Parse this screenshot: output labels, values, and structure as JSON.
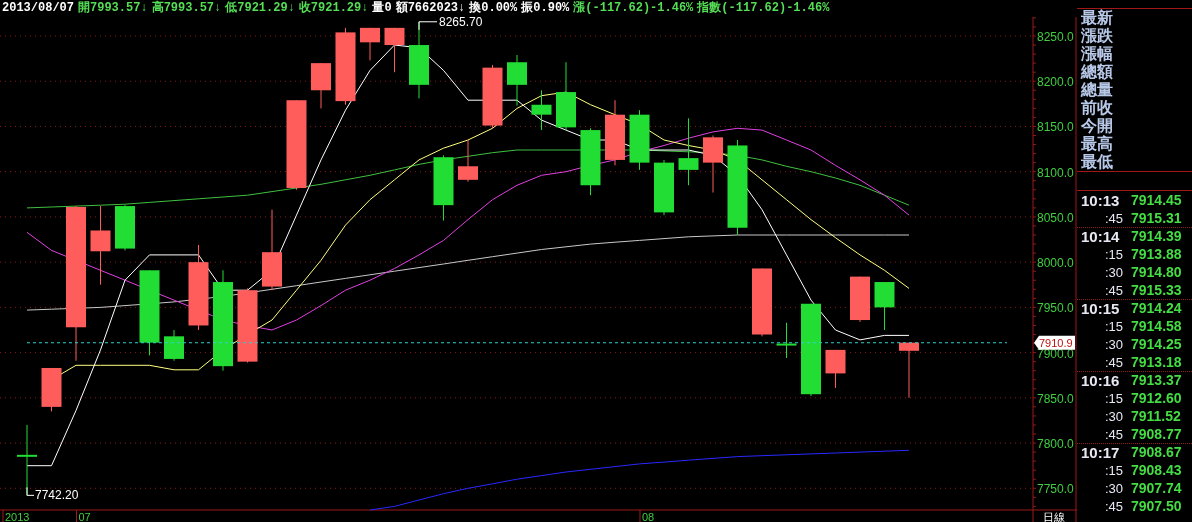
{
  "quote_bar": [
    {
      "text": "2013/08/07",
      "color": "#ffffff"
    },
    {
      "text": "開7993.57↓",
      "color": "#55dd55"
    },
    {
      "text": "高7993.57↓",
      "color": "#55dd55"
    },
    {
      "text": "低7921.29↓",
      "color": "#55dd55"
    },
    {
      "text": "收7921.29↓",
      "color": "#55dd55"
    },
    {
      "text": "量0",
      "color": "#ffffff"
    },
    {
      "text": "額7662023↓",
      "color": "#ffffff"
    },
    {
      "text": "換0.00%",
      "color": "#ffffff"
    },
    {
      "text": "振0.90%",
      "color": "#ffffff"
    },
    {
      "text": "漲(-117.62)-1.46%",
      "color": "#55dd55"
    },
    {
      "text": "指數(-117.62)-1.46%",
      "color": "#55dd55"
    }
  ],
  "chart": {
    "y_axis_labels": [
      "8250.0",
      "8200.0",
      "8150.0",
      "8100.0",
      "8050.0",
      "8000.0",
      "7950.0",
      "7900.0",
      "7850.0",
      "7800.0",
      "7750.0"
    ],
    "x_axis_labels": [
      "2013",
      "07",
      "08"
    ],
    "high_label": "8265.70",
    "low_label": "7742.20",
    "last_price_tag": "7910.9",
    "period_label": "日線"
  },
  "quote_panel": {
    "labels": [
      "最新",
      "漲跌",
      "漲幅",
      "總額",
      "總量",
      "前收",
      "今開",
      "最高",
      "最低"
    ]
  },
  "ticks": [
    {
      "kind": "minute",
      "time": "10:13",
      "price": "7914.45"
    },
    {
      "kind": "second",
      "time": ":45",
      "price": "7915.31"
    },
    {
      "kind": "minute",
      "time": "10:14",
      "price": "7914.39"
    },
    {
      "kind": "second",
      "time": ":15",
      "price": "7913.88"
    },
    {
      "kind": "second",
      "time": ":30",
      "price": "7914.80"
    },
    {
      "kind": "second",
      "time": ":45",
      "price": "7915.33"
    },
    {
      "kind": "minute",
      "time": "10:15",
      "price": "7914.24"
    },
    {
      "kind": "second",
      "time": ":15",
      "price": "7914.58"
    },
    {
      "kind": "second",
      "time": ":30",
      "price": "7914.25"
    },
    {
      "kind": "second",
      "time": ":45",
      "price": "7913.18"
    },
    {
      "kind": "minute",
      "time": "10:16",
      "price": "7913.37"
    },
    {
      "kind": "second",
      "time": ":15",
      "price": "7912.60"
    },
    {
      "kind": "second",
      "time": ":30",
      "price": "7911.52"
    },
    {
      "kind": "second",
      "time": ":45",
      "price": "7908.77"
    },
    {
      "kind": "minute",
      "time": "10:17",
      "price": "7908.67"
    },
    {
      "kind": "second",
      "time": ":15",
      "price": "7908.43"
    },
    {
      "kind": "second",
      "time": ":30",
      "price": "7907.74"
    },
    {
      "kind": "second",
      "time": ":45",
      "price": "7907.50"
    }
  ]
}
